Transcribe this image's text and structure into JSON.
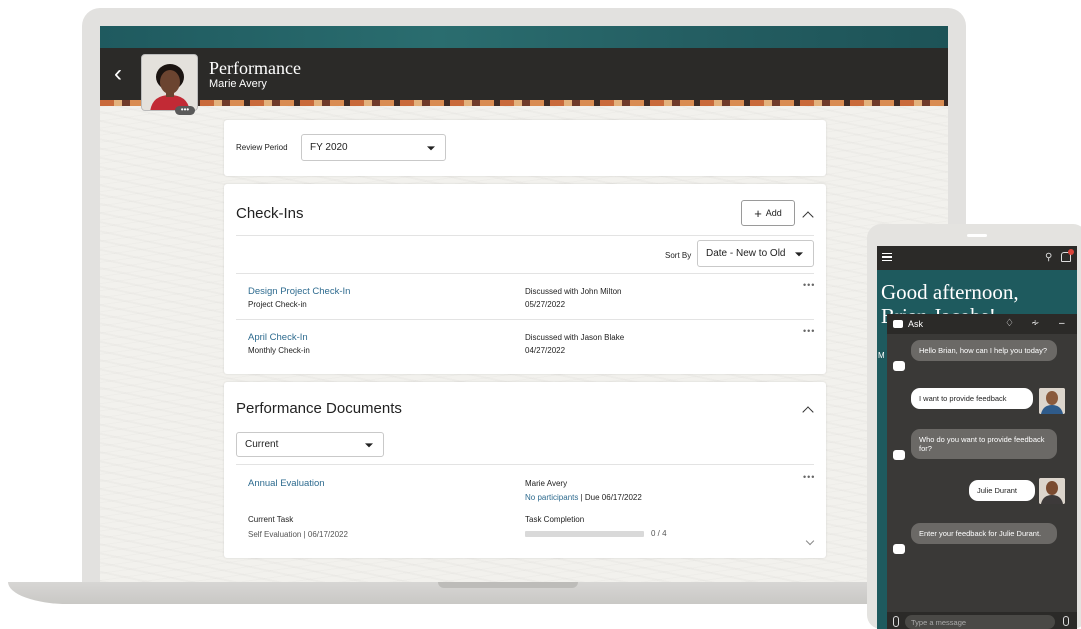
{
  "header": {
    "title": "Performance",
    "subtitle": "Marie Avery"
  },
  "review_period": {
    "label": "Review Period",
    "value": "FY 2020"
  },
  "checkins": {
    "title": "Check-Ins",
    "add_label": "Add",
    "sort_label": "Sort By",
    "sort_value": "Date - New to Old",
    "items": [
      {
        "title": "Design Project Check-In",
        "type": "Project Check-in",
        "discussed": "Discussed with John Milton",
        "date": "05/27/2022"
      },
      {
        "title": "April Check-In",
        "type": "Monthly Check-in",
        "discussed": "Discussed with Jason Blake",
        "date": "04/27/2022"
      }
    ]
  },
  "documents": {
    "title": "Performance Documents",
    "filter_value": "Current",
    "item": {
      "title": "Annual Evaluation",
      "owner": "Marie Avery",
      "participants": "No participants",
      "due": "| Due 06/17/2022",
      "current_task_label": "Current Task",
      "current_task_value": "Self Evaluation | 06/17/2022",
      "task_completion_label": "Task Completion",
      "task_completion_text": "0 / 4",
      "task_completion_fraction": 0
    }
  },
  "phone": {
    "greeting_line1": "Good afternoon,",
    "greeting_line2": "Brian Jacobs!",
    "side_letter": "M",
    "chat": {
      "title": "Ask",
      "messages": [
        {
          "from": "bot",
          "text": "Hello Brian, how can I help you today?"
        },
        {
          "from": "user",
          "text": "I want to provide feedback"
        },
        {
          "from": "bot",
          "text": "Who do you want to provide feedback for?"
        },
        {
          "from": "user",
          "text": "Julie Durant"
        },
        {
          "from": "bot",
          "text": "Enter your feedback for Julie Durant."
        }
      ],
      "input_placeholder": "Type a message"
    }
  },
  "colors": {
    "link": "#2e6b8f",
    "header_dark": "#2b2a28",
    "teal": "#1e5a5e"
  },
  "icons": [
    "back-icon",
    "chevron-down-icon",
    "plus-icon",
    "chevron-up-icon",
    "more-icon",
    "menu-icon",
    "search-icon",
    "bell-icon",
    "chat-icon",
    "eraser-icon",
    "mute-icon",
    "minimize-icon",
    "paperclip-icon",
    "mic-icon"
  ]
}
